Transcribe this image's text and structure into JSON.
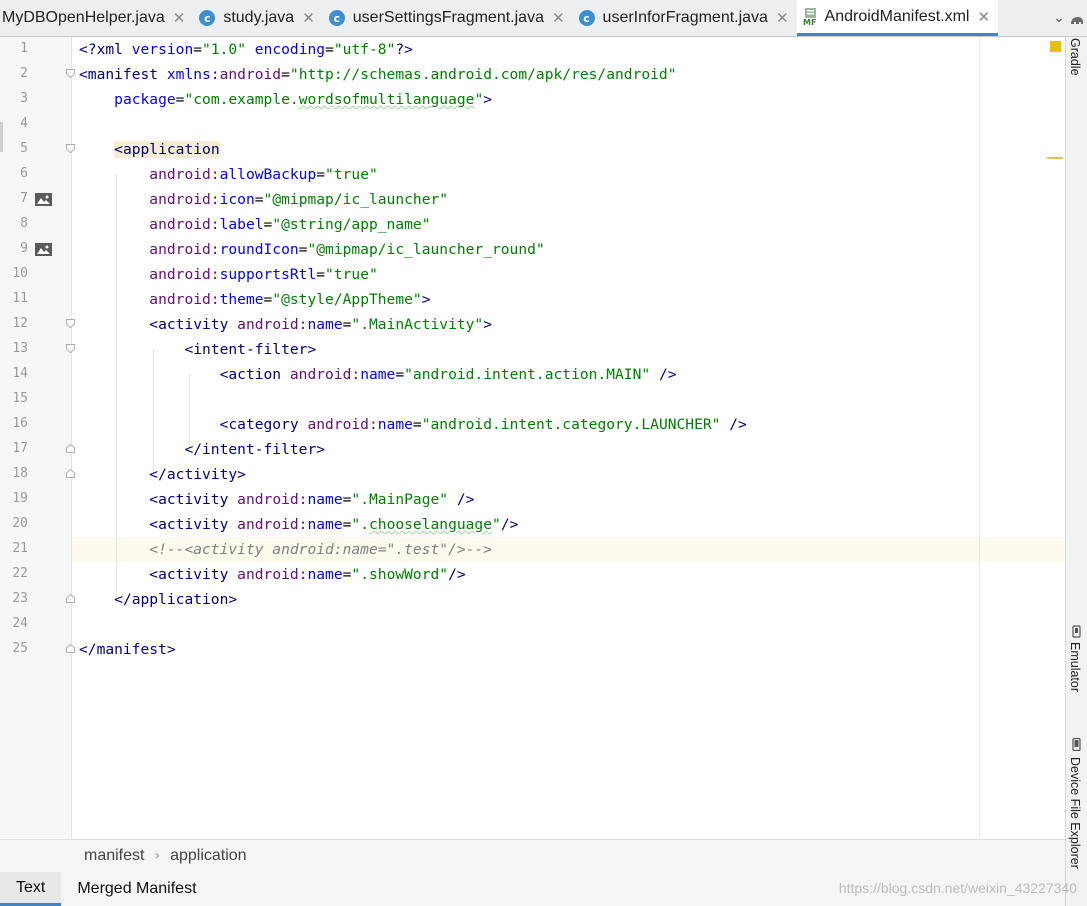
{
  "tabs": [
    {
      "label": "MyDBOpenHelper.java",
      "icon": "java-class-icon",
      "active": false
    },
    {
      "label": "study.java",
      "icon": "java-class-icon",
      "active": false
    },
    {
      "label": "userSettingsFragment.java",
      "icon": "java-class-icon",
      "active": false
    },
    {
      "label": "userInforFragment.java",
      "icon": "java-class-icon",
      "active": false
    },
    {
      "label": "AndroidManifest.xml",
      "icon": "manifest-file-icon",
      "active": true
    }
  ],
  "tab_icon_letter": "c",
  "manifest_icon_text": "MF",
  "close_glyph": "✕",
  "overflow_glyph": "⌄",
  "line_numbers": [
    "1",
    "2",
    "3",
    "4",
    "5",
    "6",
    "7",
    "8",
    "9",
    "10",
    "11",
    "12",
    "13",
    "14",
    "15",
    "16",
    "17",
    "18",
    "19",
    "20",
    "21",
    "22",
    "23",
    "24",
    "25"
  ],
  "code": {
    "l1": {
      "a": "<?",
      "b": "xml ",
      "c": "version",
      "d": "=",
      "e": "\"1.0\"",
      "f": " ",
      "g": "encoding",
      "h": "=",
      "i": "\"utf-8\"",
      "j": "?>"
    },
    "l2": {
      "a": "<manifest ",
      "b": "xmlns:",
      "c": "android",
      "d": "=",
      "e": "\"http://schemas.android.com/apk/res/android\""
    },
    "l3": {
      "a": "package",
      "b": "=",
      "c": "\"com.example.",
      "d": "wordsofmultilanguage",
      "e": "\"",
      "f": ">"
    },
    "l5": {
      "a": "<",
      "b": "application"
    },
    "l6": {
      "a": "android:",
      "b": "allowBackup",
      "c": "=",
      "d": "\"true\""
    },
    "l7": {
      "a": "android:",
      "b": "icon",
      "c": "=",
      "d": "\"@mipmap/ic_launcher\""
    },
    "l8": {
      "a": "android:",
      "b": "label",
      "c": "=",
      "d": "\"@string/app_name\""
    },
    "l9": {
      "a": "android:",
      "b": "roundIcon",
      "c": "=",
      "d": "\"@mipmap/ic_launcher_round\""
    },
    "l10": {
      "a": "android:",
      "b": "supportsRtl",
      "c": "=",
      "d": "\"true\""
    },
    "l11": {
      "a": "android:",
      "b": "theme",
      "c": "=",
      "d": "\"@style/AppTheme\"",
      "e": ">"
    },
    "l12": {
      "a": "<activity ",
      "b": "android:",
      "c": "name",
      "d": "=",
      "e": "\".MainActivity\"",
      "f": ">"
    },
    "l13": {
      "a": "<intent-filter>"
    },
    "l14": {
      "a": "<action ",
      "b": "android:",
      "c": "name",
      "d": "=",
      "e": "\"android.intent.action.MAIN\"",
      "f": " />"
    },
    "l16": {
      "a": "<category ",
      "b": "android:",
      "c": "name",
      "d": "=",
      "e": "\"android.intent.category.LAUNCHER\"",
      "f": " />"
    },
    "l17": {
      "a": "</intent-filter>"
    },
    "l18": {
      "a": "</activity>"
    },
    "l19": {
      "a": "<activity ",
      "b": "android:",
      "c": "name",
      "d": "=",
      "e": "\".MainPage\"",
      "f": " />"
    },
    "l20": {
      "a": "<activity ",
      "b": "android:",
      "c": "name",
      "d": "=",
      "e": "\".",
      "f": "chooselanguage",
      "g": "\"",
      "h": "/>"
    },
    "l21": {
      "a": "<!--<activity android:name=\".test\"/>-->"
    },
    "l22": {
      "a": "<activity ",
      "b": "android:",
      "c": "name",
      "d": "=",
      "e": "\".showWord\"",
      "f": "/>"
    },
    "l23": {
      "a": "</application>"
    },
    "l25": {
      "a": "</manifest>"
    }
  },
  "right_panel": {
    "gradle": "Gradle",
    "emulator": "Emulator",
    "device_explorer": "Device File Explorer"
  },
  "breadcrumb": [
    "manifest",
    "application"
  ],
  "breadcrumb_sep": "›",
  "bottom_tabs": [
    {
      "label": "Text",
      "active": true
    },
    {
      "label": "Merged Manifest",
      "active": false
    }
  ],
  "watermark": "https://blog.csdn.net/weixin_43227340",
  "colors": {
    "accent": "#4083c9",
    "tag": "#000080",
    "attr": "#0000ff",
    "namespace": "#660e7a",
    "value": "#008000",
    "comment": "#808080",
    "warning_marker": "#e8b800"
  }
}
